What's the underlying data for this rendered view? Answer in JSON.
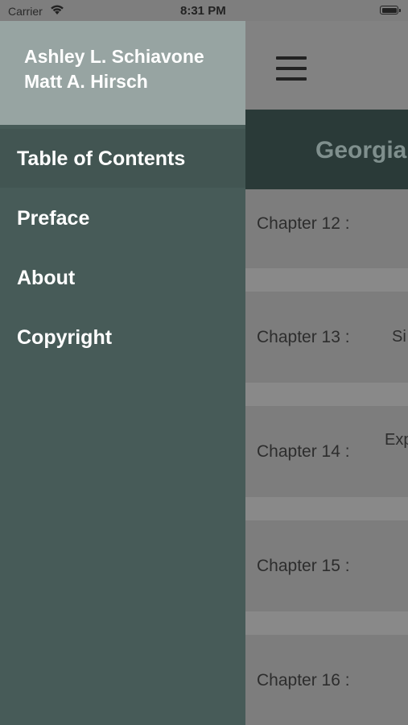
{
  "status_bar": {
    "carrier": "Carrier",
    "time": "8:31 PM"
  },
  "drawer": {
    "authors": [
      "Ashley L. Schiavone",
      "Matt A. Hirsch"
    ],
    "menu": [
      {
        "label": "Table of Contents"
      },
      {
        "label": "Preface"
      },
      {
        "label": "About"
      },
      {
        "label": "Copyright"
      }
    ]
  },
  "background": {
    "title": "Georgia",
    "chapters": [
      {
        "label": "Chapter 12 :",
        "peek": ""
      },
      {
        "label": "Chapter 13 :",
        "peek": "Si"
      },
      {
        "label": "Chapter 14 :",
        "peek": "Exp"
      },
      {
        "label": "Chapter 15 :",
        "peek": ""
      },
      {
        "label": "Chapter 16 :",
        "peek": ""
      }
    ]
  }
}
